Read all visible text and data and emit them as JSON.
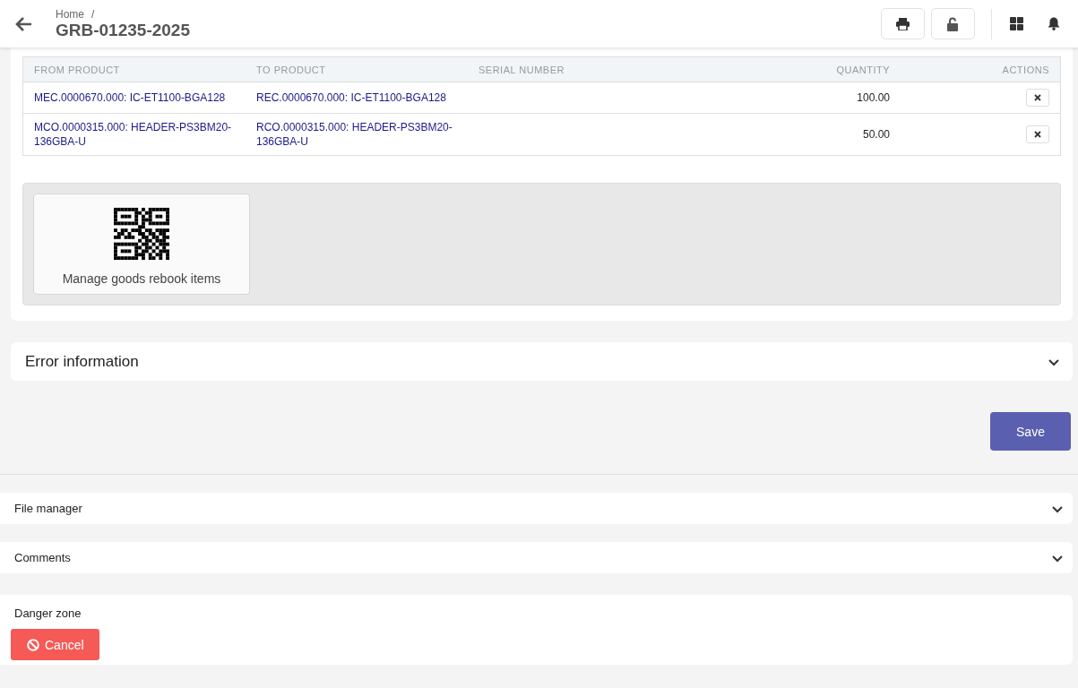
{
  "header": {
    "breadcrumb": "Home",
    "breadcrumb_separator": "/",
    "title": "GRB-01235-2025"
  },
  "table": {
    "columns": [
      "FROM PRODUCT",
      "TO PRODUCT",
      "SERIAL NUMBER",
      "QUANTITY",
      "ACTIONS"
    ],
    "rows": [
      {
        "from_product": "MEC.0000670.000: IC-ET1100-BGA128",
        "to_product": "REC.0000670.000: IC-ET1100-BGA128",
        "quantity": "100.00"
      },
      {
        "from_product": "MCO.0000315.000: HEADER-PS3BM20-136GBA-U",
        "to_product": "RCO.0000315.000: HEADER-PS3BM20-136GBA-U",
        "quantity": "50.00"
      }
    ]
  },
  "tile": {
    "label": "Manage goods rebook items"
  },
  "error_section": {
    "title": "Error information",
    "expanded": false
  },
  "save_button": "Save",
  "panels": [
    {
      "title": "File manager",
      "expanded": false
    },
    {
      "title": "Comments",
      "expanded": false
    }
  ],
  "danger_zone": {
    "title": "Danger zone",
    "cancel_button": "Cancel"
  }
}
